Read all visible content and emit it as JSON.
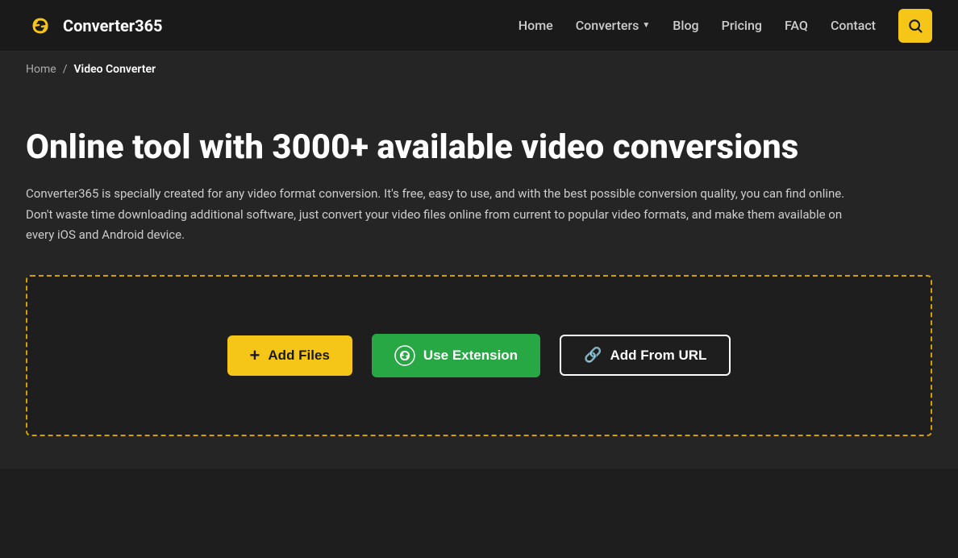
{
  "brand": {
    "name": "Converter365"
  },
  "nav": {
    "home": "Home",
    "converters": "Converters",
    "blog": "Blog",
    "pricing": "Pricing",
    "faq": "FAQ",
    "contact": "Contact"
  },
  "breadcrumb": {
    "home": "Home",
    "separator": "/",
    "current": "Video Converter"
  },
  "hero": {
    "title": "Online tool with 3000+ available video conversions",
    "description": "Converter365 is specially created for any video format conversion. It's free, easy to use, and with the best possible conversion quality, you can find online. Don't waste time downloading additional software, just convert your video files online from current to popular video formats, and make them available on every iOS and Android device."
  },
  "upload": {
    "add_files_label": "Add Files",
    "use_extension_label": "Use Extension",
    "add_url_label": "Add From URL"
  },
  "colors": {
    "yellow": "#f5c518",
    "green": "#27a844",
    "dark_bg": "#1e1e1e",
    "navbar_bg": "#1a1a1a",
    "section_bg": "#252525",
    "dashed_border": "#d4a000"
  }
}
